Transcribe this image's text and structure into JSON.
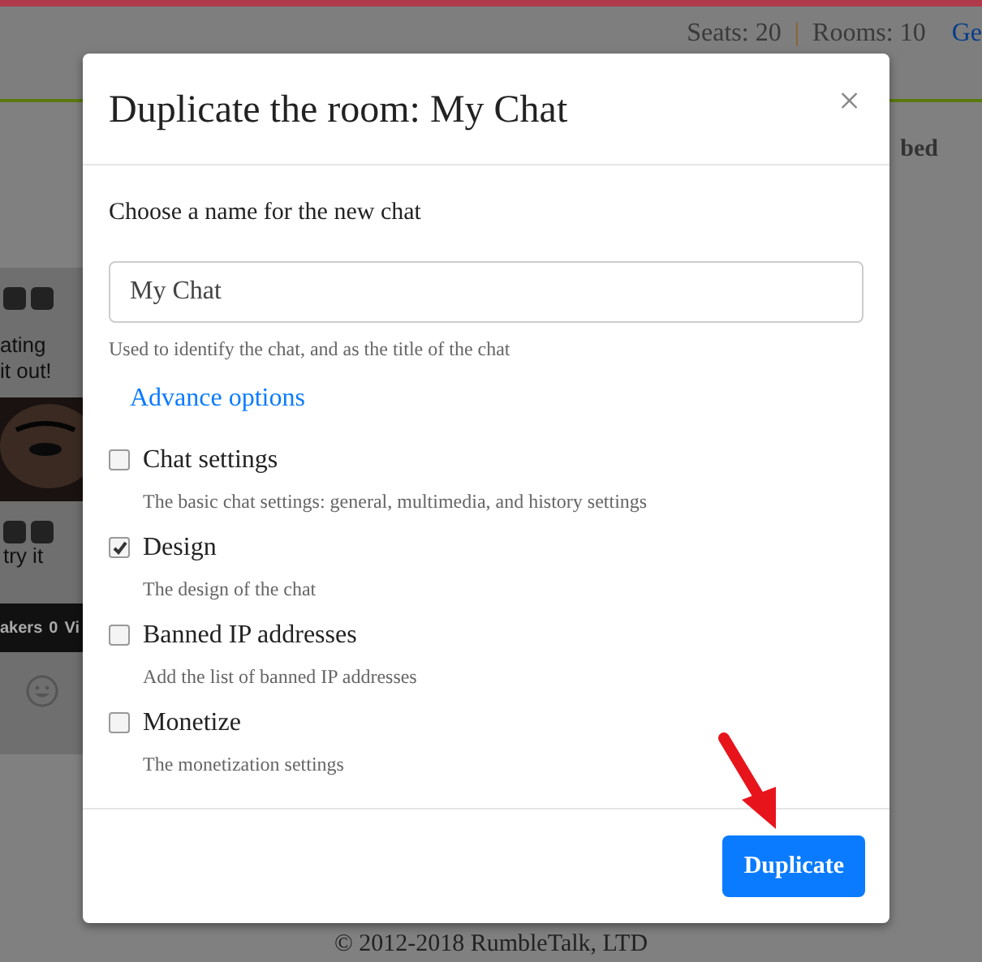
{
  "background": {
    "seats": "Seats: 20",
    "separator": "|",
    "rooms": "Rooms: 10",
    "link": "Ge",
    "tab": "bed",
    "card_texts": [
      "ating",
      "it out!",
      "try it"
    ],
    "stats": [
      "akers",
      "0",
      "Vi"
    ],
    "footer": "© 2012-2018 RumbleTalk, LTD"
  },
  "dialog": {
    "title": "Duplicate the room: My Chat",
    "close": "×",
    "prompt": "Choose a name for the new chat",
    "name_field": {
      "value": "My Chat"
    },
    "hint": "Used to identify the chat, and as the title of the chat",
    "advance_link": "Advance options",
    "options": [
      {
        "label": "Chat settings",
        "description": "The basic chat settings: general, multimedia, and history settings",
        "checked": false
      },
      {
        "label": "Design",
        "description": "The design of the chat",
        "checked": true
      },
      {
        "label": "Banned IP addresses",
        "description": "Add the list of banned IP addresses",
        "checked": false
      },
      {
        "label": "Monetize",
        "description": "The monetization settings",
        "checked": false
      }
    ],
    "button": "Duplicate"
  }
}
